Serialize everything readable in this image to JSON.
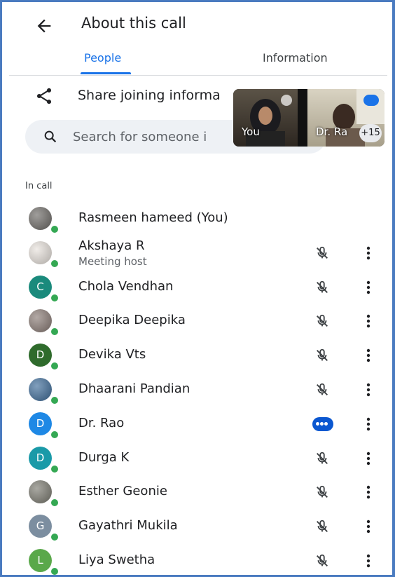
{
  "header": {
    "title": "About this call",
    "tabs": [
      "People",
      "Information"
    ]
  },
  "share": {
    "label": "Share joining informa"
  },
  "search": {
    "placeholder": "Search for someone i"
  },
  "video_strip": {
    "tiles": [
      {
        "name": "You"
      },
      {
        "name": "Dr. Ra"
      }
    ],
    "more_count": "+15"
  },
  "section": {
    "in_call": "In call"
  },
  "people": [
    {
      "name": "Rasmeen hameed (You)",
      "role": "",
      "avatar_letter": "",
      "avatar_color": "#6d6a66",
      "mic": "none"
    },
    {
      "name": "Akshaya R",
      "role": "Meeting host",
      "avatar_letter": "",
      "avatar_color": "#e8e2dc",
      "mic": "off"
    },
    {
      "name": "Chola Vendhan",
      "role": "",
      "avatar_letter": "C",
      "avatar_color": "#1a8a7c",
      "mic": "off"
    },
    {
      "name": "Deepika Deepika",
      "role": "",
      "avatar_letter": "",
      "avatar_color": "#8a7b75",
      "mic": "off"
    },
    {
      "name": "Devika Vts",
      "role": "",
      "avatar_letter": "D",
      "avatar_color": "#2f6b2c",
      "mic": "off"
    },
    {
      "name": "Dhaarani Pandian",
      "role": "",
      "avatar_letter": "",
      "avatar_color": "#3d6c9a",
      "mic": "off"
    },
    {
      "name": "Dr. Rao",
      "role": "",
      "avatar_letter": "D",
      "avatar_color": "#1e88e5",
      "mic": "speaking"
    },
    {
      "name": "Durga K",
      "role": "",
      "avatar_letter": "D",
      "avatar_color": "#1a9aa8",
      "mic": "off"
    },
    {
      "name": "Esther Geonie",
      "role": "",
      "avatar_letter": "",
      "avatar_color": "#7b7a70",
      "mic": "off"
    },
    {
      "name": "Gayathri Mukila",
      "role": "",
      "avatar_letter": "G",
      "avatar_color": "#7c8ea0",
      "mic": "off"
    },
    {
      "name": "Liya Swetha",
      "role": "",
      "avatar_letter": "L",
      "avatar_color": "#5aa84a",
      "mic": "off"
    }
  ],
  "colors": {
    "accent": "#1a73e8",
    "presence": "#34a853",
    "frame": "#4a7bc0"
  }
}
